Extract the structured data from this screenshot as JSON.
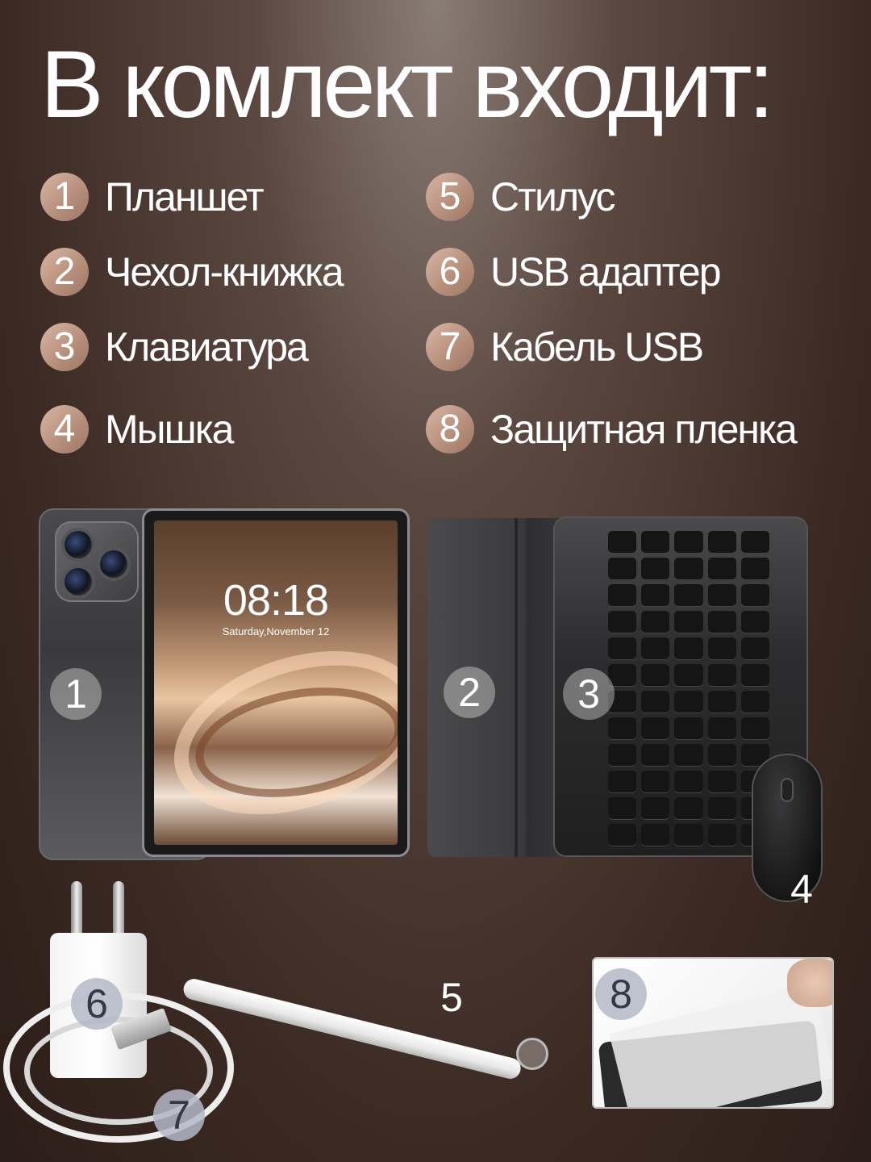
{
  "title": "В комлект входит:",
  "items": [
    {
      "num": "1",
      "label": "Планшет"
    },
    {
      "num": "2",
      "label": "Чехол-книжка"
    },
    {
      "num": "3",
      "label": "Клавиатура"
    },
    {
      "num": "4",
      "label": "Мышка"
    },
    {
      "num": "5",
      "label": "Стилус"
    },
    {
      "num": "6",
      "label": "USB адаптер"
    },
    {
      "num": "7",
      "label": "Кабель USB"
    },
    {
      "num": "8",
      "label": "Защитная пленка"
    }
  ],
  "tablet_screen": {
    "time": "08:18",
    "date": "Saturday,November 12"
  },
  "photo_badges": [
    "1",
    "2",
    "3",
    "4",
    "5",
    "6",
    "7",
    "8"
  ],
  "colors": {
    "badge": "#c29c88",
    "background": "#3b2a23",
    "text": "#ffffff"
  }
}
